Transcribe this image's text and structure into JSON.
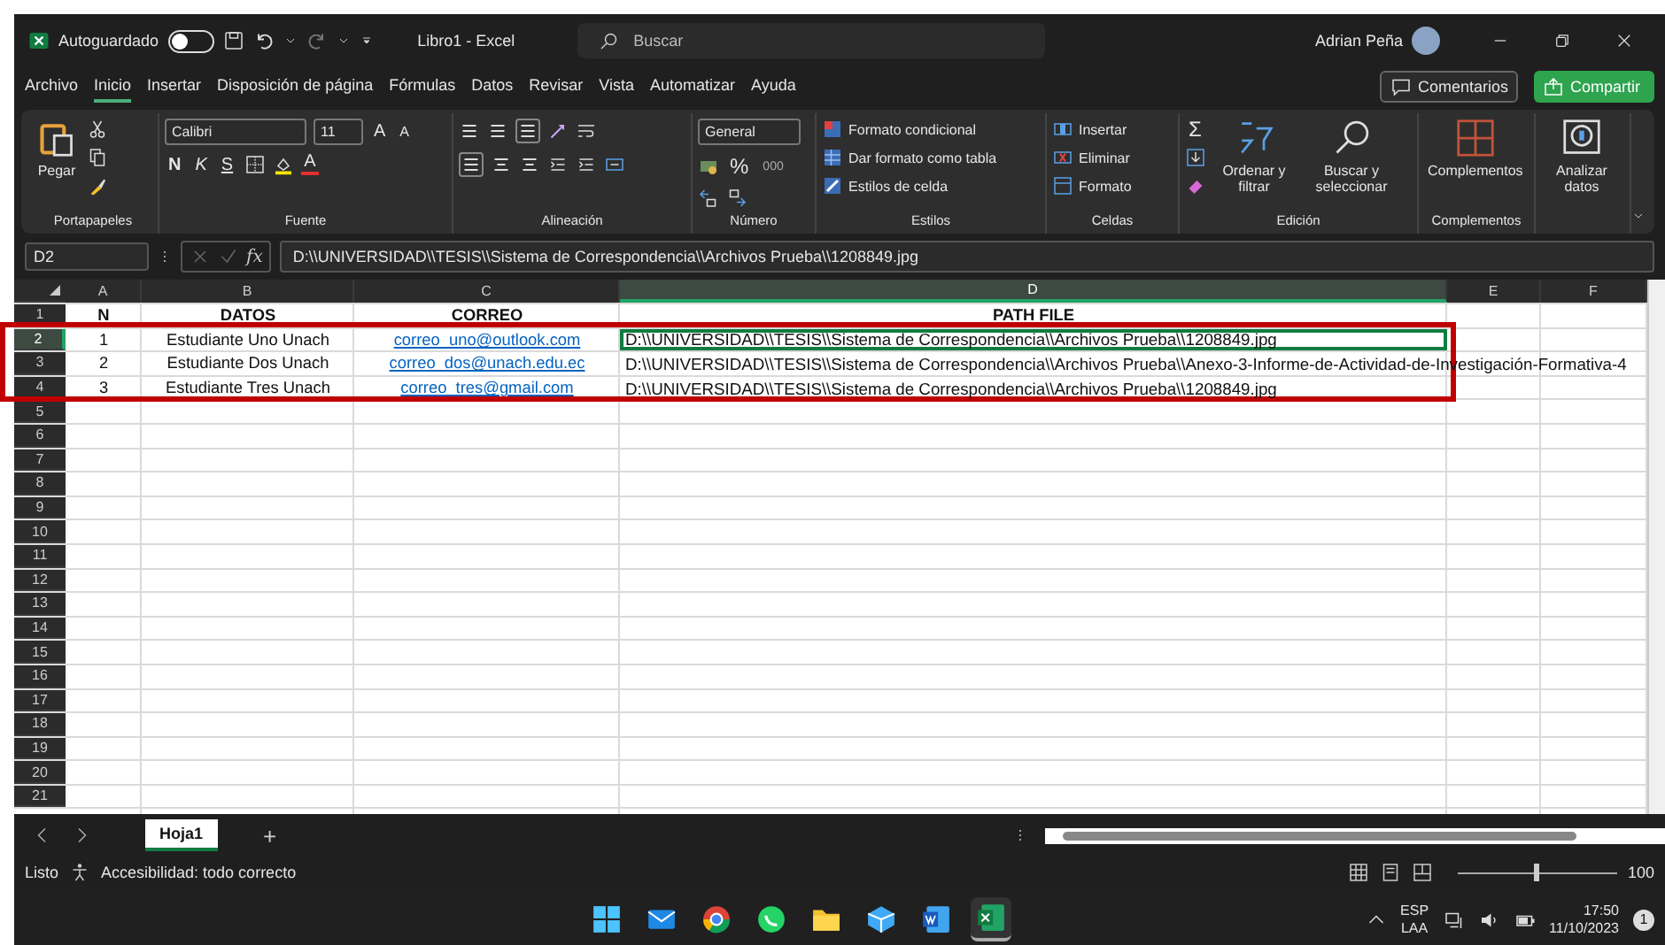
{
  "title_bar": {
    "autosave_label": "Autoguardado",
    "autosave_on": false,
    "document_title": "Libro1 - Excel",
    "search": {
      "placeholder": "Buscar"
    },
    "user": "Adrian Peña"
  },
  "menu_tabs": [
    {
      "label": "Archivo",
      "selected": false
    },
    {
      "label": "Inicio",
      "selected": true
    },
    {
      "label": "Insertar",
      "selected": false
    },
    {
      "label": "Disposición de página",
      "selected": false
    },
    {
      "label": "Fórmulas",
      "selected": false
    },
    {
      "label": "Datos",
      "selected": false
    },
    {
      "label": "Revisar",
      "selected": false
    },
    {
      "label": "Vista",
      "selected": false
    },
    {
      "label": "Automatizar",
      "selected": false
    },
    {
      "label": "Ayuda",
      "selected": false
    }
  ],
  "actions": {
    "comments": "Comentarios",
    "share": "Compartir"
  },
  "ribbon": [
    {
      "kind": "clipboard",
      "name": "Portapapeles",
      "paste": "Pegar"
    },
    {
      "kind": "font",
      "name": "Fuente",
      "font": "Calibri",
      "size": "11",
      "grow": "A",
      "shrink": "A",
      "bold": "N",
      "italic": "K",
      "underline": "S",
      "font_color": "A"
    },
    {
      "kind": "alignment",
      "name": "Alineación"
    },
    {
      "kind": "number",
      "name": "Número",
      "format": "General",
      "percent": "%",
      "thousands": "000"
    },
    {
      "kind": "list",
      "name": "Estilos",
      "items": [
        "Formato condicional",
        "Dar formato como tabla",
        "Estilos de celda"
      ]
    },
    {
      "kind": "list",
      "name": "Celdas",
      "items": [
        "Insertar",
        "Eliminar",
        "Formato"
      ]
    },
    {
      "kind": "editing",
      "name": "Edición",
      "sum": "Σ",
      "sort": "Ordenar y filtrar",
      "find": "Buscar y seleccionar"
    },
    {
      "kind": "addins",
      "name": "Complementos",
      "label": "Complementos"
    },
    {
      "kind": "analyze",
      "label": "Analizar datos"
    }
  ],
  "formula_bar": {
    "name_box": "D2",
    "fx": "fx",
    "value": "D:\\\\UNIVERSIDAD\\\\TESIS\\\\Sistema de Correspondencia\\\\Archivos Prueba\\\\1208849.jpg"
  },
  "columns": [
    {
      "label": "A",
      "selected": false
    },
    {
      "label": "B",
      "selected": false
    },
    {
      "label": "C",
      "selected": false
    },
    {
      "label": "D",
      "selected": true
    },
    {
      "label": "E",
      "selected": false
    },
    {
      "label": "F",
      "selected": false
    }
  ],
  "rows": [
    {
      "number": "1",
      "selected": false,
      "cells": [
        {
          "kind": "header",
          "text": "N"
        },
        {
          "kind": "header",
          "text": "DATOS"
        },
        {
          "kind": "header",
          "text": "CORREO"
        },
        {
          "kind": "header",
          "text": "PATH FILE"
        }
      ]
    },
    {
      "number": "2",
      "selected": true,
      "cells": [
        {
          "kind": "center",
          "text": "1"
        },
        {
          "kind": "center",
          "text": "Estudiante Uno Unach"
        },
        {
          "kind": "link",
          "text": "correo_uno@outlook.com"
        },
        {
          "kind": "path",
          "text": "D:\\\\UNIVERSIDAD\\\\TESIS\\\\Sistema de Correspondencia\\\\Archivos Prueba\\\\1208849.jpg"
        }
      ]
    },
    {
      "number": "3",
      "selected": false,
      "cells": [
        {
          "kind": "center",
          "text": "2"
        },
        {
          "kind": "center",
          "text": "Estudiante Dos Unach"
        },
        {
          "kind": "link",
          "text": "correo_dos@unach.edu.ec"
        },
        {
          "kind": "path",
          "text": "D:\\\\UNIVERSIDAD\\\\TESIS\\\\Sistema de Correspondencia\\\\Archivos Prueba\\\\Anexo-3-Informe-de-Actividad-de-Investigación-Formativa-4"
        }
      ]
    },
    {
      "number": "4",
      "selected": false,
      "cells": [
        {
          "kind": "center",
          "text": "3"
        },
        {
          "kind": "center",
          "text": "Estudiante Tres Unach"
        },
        {
          "kind": "link",
          "text": "correo_tres@gmail.com"
        },
        {
          "kind": "path",
          "text": "D:\\\\UNIVERSIDAD\\\\TESIS\\\\Sistema de Correspondencia\\\\Archivos Prueba\\\\1208849.jpg"
        }
      ]
    },
    {
      "number": "5",
      "selected": false
    },
    {
      "number": "6",
      "selected": false
    },
    {
      "number": "7",
      "selected": false
    },
    {
      "number": "8",
      "selected": false
    },
    {
      "number": "9",
      "selected": false
    },
    {
      "number": "10",
      "selected": false
    },
    {
      "number": "11",
      "selected": false
    },
    {
      "number": "12",
      "selected": false
    },
    {
      "number": "13",
      "selected": false
    },
    {
      "number": "14",
      "selected": false
    },
    {
      "number": "15",
      "selected": false
    },
    {
      "number": "16",
      "selected": false
    },
    {
      "number": "17",
      "selected": false
    },
    {
      "number": "18",
      "selected": false
    },
    {
      "number": "19",
      "selected": false
    },
    {
      "number": "20",
      "selected": false
    },
    {
      "number": "21",
      "selected": false
    }
  ],
  "sheet_tabs": [
    {
      "label": "Hoja1",
      "selected": true
    }
  ],
  "add_sheet": "+",
  "status_bar": {
    "ready": "Listo",
    "accessibility": "Accesibilidad: todo correcto",
    "zoom": "100",
    "zoom_slider": {
      "level": 0.48
    }
  },
  "highlight": {
    "color": "#c00000"
  },
  "taskbar": {
    "language": "ESP",
    "layout": "LAA",
    "time": "17:50",
    "date": "11/10/2023",
    "notifications": "1"
  }
}
